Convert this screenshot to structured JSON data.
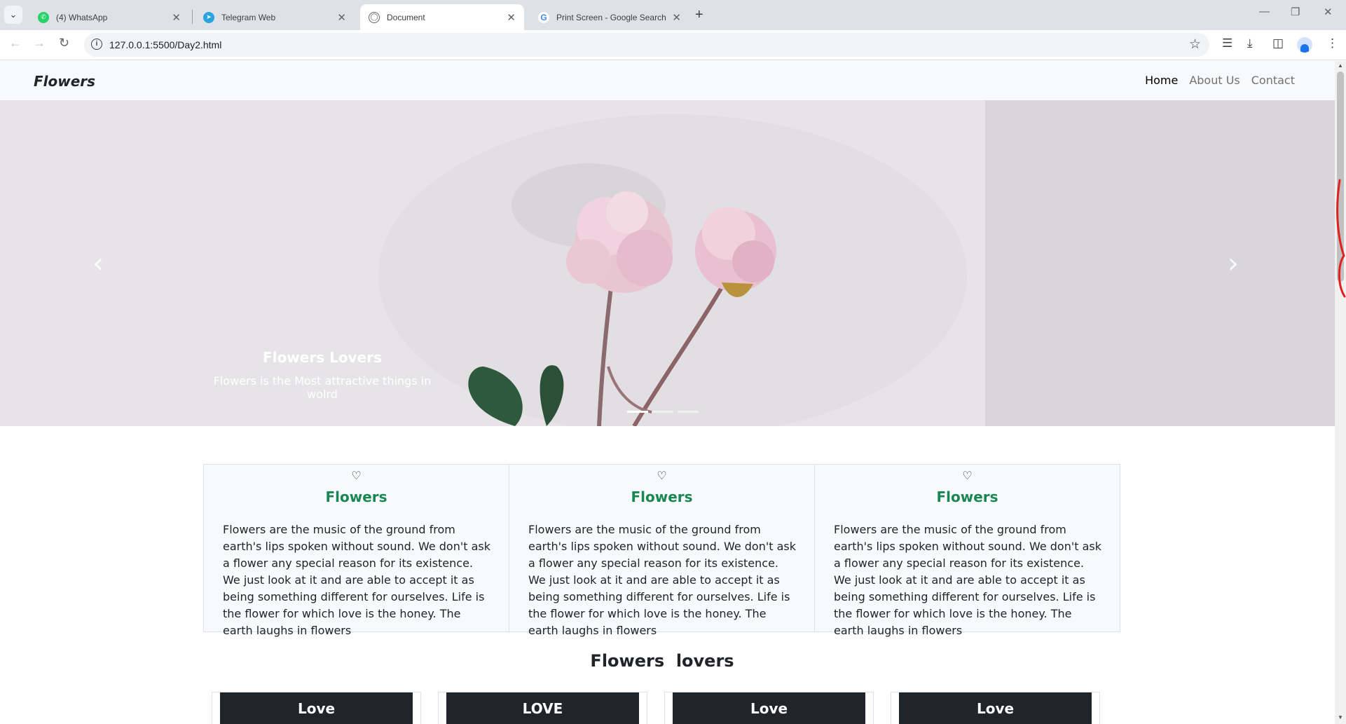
{
  "browser": {
    "tabs": [
      {
        "title": "(4) WhatsApp",
        "favicon": "whatsapp-icon",
        "color": "#25d366",
        "active": false
      },
      {
        "title": "Telegram Web",
        "favicon": "telegram-icon",
        "color": "#2aa3e0",
        "active": false
      },
      {
        "title": "Document",
        "favicon": "globe-icon",
        "color": "#5f6368",
        "active": true
      },
      {
        "title": "Print Screen - Google Search",
        "favicon": "google-icon",
        "color": "#4285f4",
        "active": false
      }
    ],
    "url": "127.0.0.1:5500/Day2.html"
  },
  "site": {
    "brand": "Flowers",
    "nav": [
      {
        "label": "Home",
        "active": true
      },
      {
        "label": "About Us",
        "active": false
      },
      {
        "label": "Contact",
        "active": false
      }
    ],
    "carousel": {
      "caption_title": "Flowers Lovers",
      "caption_text": "Flowers is the Most attractive things in wolrd",
      "slides": 3,
      "active_slide": 1
    },
    "cards": [
      {
        "icon": "heart-icon",
        "title": "Flowers",
        "text": "Flowers are the music of the ground from earth's lips spoken without sound. We don't ask a flower any special reason for its existence. We just look at it and are able to accept it as being something different for ourselves. Life is the flower for which love is the honey. The earth laughs in flowers"
      },
      {
        "icon": "heart-icon",
        "title": "Flowers",
        "text": "Flowers are the music of the ground from earth's lips spoken without sound. We don't ask a flower any special reason for its existence. We just look at it and are able to accept it as being something different for ourselves. Life is the flower for which love is the honey. The earth laughs in flowers"
      },
      {
        "icon": "heart-icon",
        "title": "Flowers",
        "text": "Flowers are the music of the ground from earth's lips spoken without sound. We don't ask a flower any special reason for its existence. We just look at it and are able to accept it as being something different for ourselves. Life is the flower for which love is the honey. The earth laughs in flowers"
      }
    ],
    "section_title": "Flowers  lovers",
    "love_cards": [
      "Love",
      "LOVE",
      "Love",
      "Love"
    ],
    "colors": {
      "accent_green": "#198754",
      "dark": "#212529",
      "nav_bg": "#f8f9fa"
    }
  }
}
